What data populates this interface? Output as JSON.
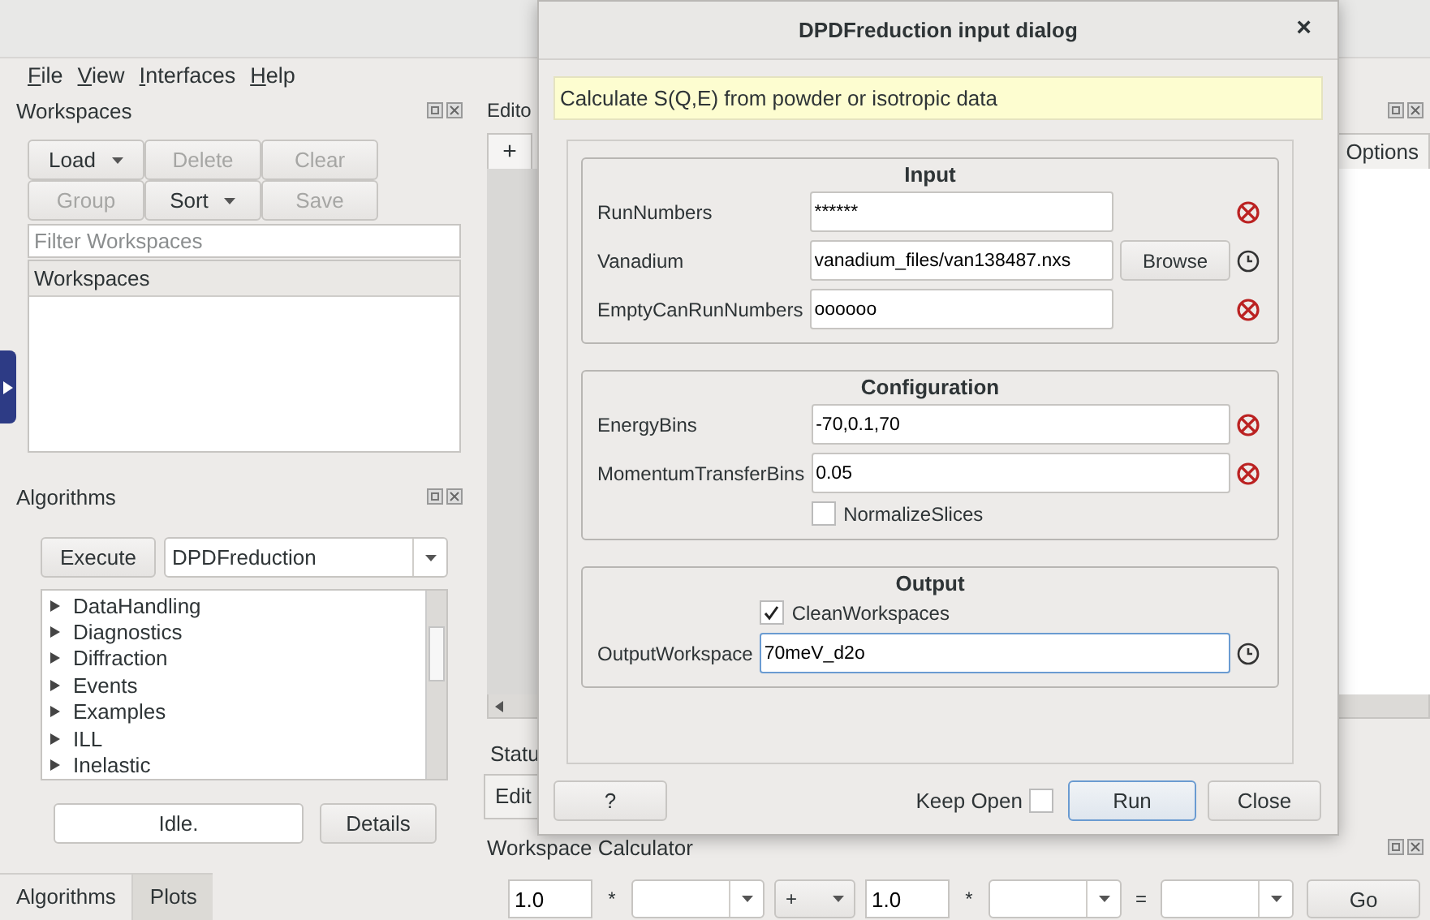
{
  "menu": [
    {
      "label": "File"
    },
    {
      "label": "View"
    },
    {
      "label": "Interfaces"
    },
    {
      "label": "Help"
    }
  ],
  "workspaces": {
    "title": "Workspaces",
    "buttons": [
      {
        "label": "Load",
        "disabled": false,
        "dropdown": true
      },
      {
        "label": "Delete",
        "disabled": true,
        "dropdown": false
      },
      {
        "label": "Clear",
        "disabled": true,
        "dropdown": false
      },
      {
        "label": "Group",
        "disabled": true,
        "dropdown": false
      },
      {
        "label": "Sort",
        "disabled": false,
        "dropdown": true
      },
      {
        "label": "Save",
        "disabled": true,
        "dropdown": false
      }
    ],
    "filter": {
      "placeholder": "Filter Workspaces"
    },
    "list_header": "Workspaces"
  },
  "algorithms": {
    "title": "Algorithms",
    "execute": "Execute",
    "combo": "DPDFreduction",
    "tree": [
      {
        "label": "DataHandling",
        "expanded": false
      },
      {
        "label": "Diagnostics",
        "expanded": false
      },
      {
        "label": "Diffraction",
        "expanded": false
      },
      {
        "label": "Events",
        "expanded": false
      },
      {
        "label": "Examples",
        "expanded": false
      },
      {
        "label": "ILL",
        "expanded": false
      },
      {
        "label": "Inelastic",
        "expanded": false
      }
    ],
    "status": "Idle.",
    "details": "Details"
  },
  "bottom_tabs": [
    {
      "label": "Algorithms",
      "selected": true
    },
    {
      "label": "Plots",
      "selected": false
    }
  ],
  "editor": {
    "title": "Edito",
    "add_tab": "+",
    "options_tab": "Options",
    "status_title": "Statu",
    "edit_tab": "Edit"
  },
  "calculator": {
    "title": "Workspace Calculator",
    "items": [
      {
        "kind": "input",
        "value": "1.0"
      },
      {
        "kind": "op",
        "text": "*"
      },
      {
        "kind": "combo",
        "value": ""
      },
      {
        "kind": "opcombo",
        "value": "+"
      },
      {
        "kind": "input",
        "value": "1.0"
      },
      {
        "kind": "op",
        "text": "*"
      },
      {
        "kind": "combo",
        "value": ""
      },
      {
        "kind": "op",
        "text": "="
      },
      {
        "kind": "combo",
        "value": ""
      },
      {
        "kind": "button",
        "text": "Go"
      }
    ]
  },
  "dialog": {
    "title": "DPDFreduction input dialog",
    "close": "×",
    "description": "Calculate S(Q,E) from powder or isotropic data",
    "groups": [
      {
        "title": "Input",
        "rows": [
          {
            "kind": "field",
            "label": "RunNumbers",
            "value": "******",
            "valid": false
          },
          {
            "kind": "field",
            "label": "Vanadium",
            "value": "vanadium_files/van138487.nxs",
            "button": "Browse",
            "valid": true
          },
          {
            "kind": "field",
            "label": "EmptyCanRunNumbers",
            "value": "oooooo",
            "valid": false
          }
        ]
      },
      {
        "title": "Configuration",
        "rows": [
          {
            "kind": "field",
            "label": "EnergyBins",
            "value": "-70,0.1,70",
            "valid": false
          },
          {
            "kind": "field",
            "label": "MomentumTransferBins",
            "value": "0.05",
            "valid": false
          },
          {
            "kind": "checkbox",
            "label": "NormalizeSlices",
            "checked": false
          }
        ]
      },
      {
        "title": "Output",
        "rows": [
          {
            "kind": "checkbox",
            "label": "CleanWorkspaces",
            "checked": true
          },
          {
            "kind": "field",
            "label": "OutputWorkspace",
            "value": "70meV_d2o",
            "valid": true,
            "focused": true
          }
        ]
      }
    ],
    "help": "?",
    "keep_open": {
      "label": "Keep Open",
      "checked": false
    },
    "run": "Run",
    "close_button": "Close"
  }
}
